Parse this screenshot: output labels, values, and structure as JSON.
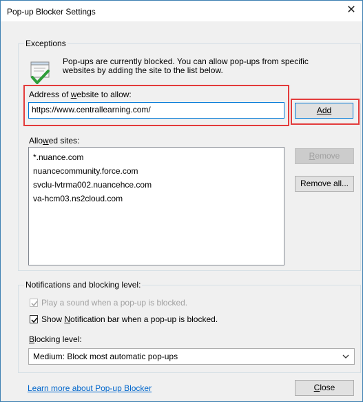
{
  "window": {
    "title": "Pop-up Blocker Settings",
    "close_glyph": "✕"
  },
  "exceptions": {
    "group_label": "Exceptions",
    "info_line1": "Pop-ups are currently blocked.  You can allow pop-ups from specific",
    "info_line2": "websites by adding the site to the list below.",
    "address_label_pre": "Address of ",
    "address_label_u": "w",
    "address_label_post": "ebsite to allow:",
    "address_value": "https://www.centrallearning.com/",
    "add_label": "Add",
    "allowed_label_pre": "Allo",
    "allowed_label_u": "w",
    "allowed_label_post": "ed sites:",
    "allowed_sites": [
      "*.nuance.com",
      "nuancecommunity.force.com",
      "svclu-lvtrma002.nuancehce.com",
      "va-hcm03.ns2cloud.com"
    ],
    "remove_label": "Remove",
    "remove_all_label": "Remove all..."
  },
  "notifications": {
    "group_label": "Notifications and blocking level:",
    "play_sound_label": "Play a sound when a pop-up is blocked.",
    "play_sound_checked": true,
    "show_bar_pre": "Show ",
    "show_bar_u": "N",
    "show_bar_post": "otification bar when a pop-up is blocked.",
    "show_bar_checked": true,
    "blocking_level_u": "B",
    "blocking_level_post": "locking level:",
    "blocking_level_value": "Medium: Block most automatic pop-ups"
  },
  "footer": {
    "learn_more": "Learn more about Pop-up Blocker",
    "close_label": "Close"
  },
  "colors": {
    "highlight": "#e33b3b",
    "link": "#0066cc",
    "accent": "#0078d7"
  },
  "icons": [
    "shield-check-icon",
    "close-icon",
    "checkmark-icon",
    "chevron-down-icon"
  ]
}
